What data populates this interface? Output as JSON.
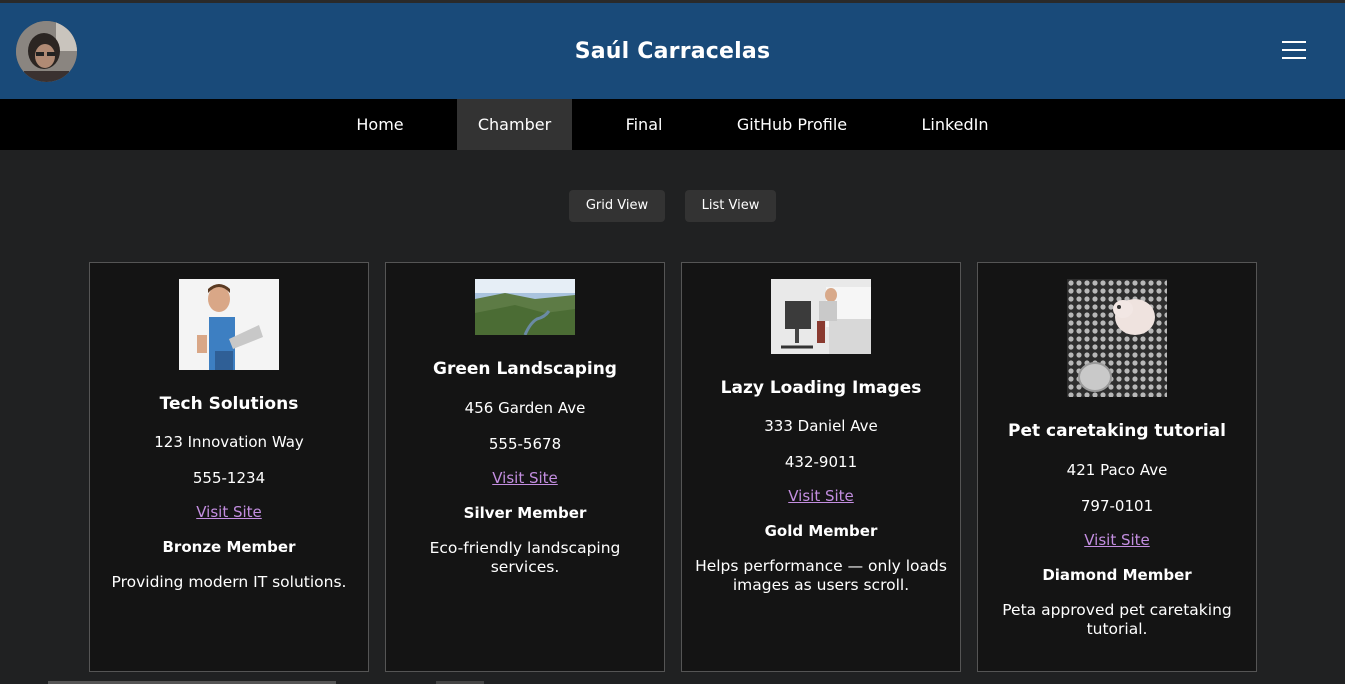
{
  "header": {
    "title": "Saúl Carracelas",
    "avatar_icon": "person-photo-icon",
    "menu_icon": "hamburger-icon"
  },
  "nav": {
    "items": [
      {
        "label": "Home"
      },
      {
        "label": "Chamber",
        "active": true
      },
      {
        "label": "Final"
      },
      {
        "label": "GitHub Profile"
      },
      {
        "label": "LinkedIn"
      }
    ]
  },
  "view_toggle": {
    "grid_label": "Grid View",
    "list_label": "List View"
  },
  "members": [
    {
      "name": "Tech Solutions",
      "address": "123 Innovation Way",
      "phone": "555-1234",
      "link": "Visit Site",
      "level": "Bronze Member",
      "description": "Providing modern IT solutions."
    },
    {
      "name": "Green Landscaping",
      "address": "456 Garden Ave",
      "phone": "555-5678",
      "link": "Visit Site",
      "level": "Silver Member",
      "description": "Eco-friendly landscaping services."
    },
    {
      "name": "Lazy Loading Images",
      "address": "333 Daniel Ave",
      "phone": "432-9011",
      "link": "Visit Site",
      "level": "Gold Member",
      "description": "Helps performance — only loads images as users scroll."
    },
    {
      "name": "Pet caretaking tutorial",
      "address": "421 Paco Ave",
      "phone": "797-0101",
      "link": "Visit Site",
      "level": "Diamond Member",
      "description": "Peta approved pet caretaking tutorial."
    }
  ],
  "colors": {
    "header_bg": "#194a79",
    "nav_bg": "#000000",
    "page_bg": "#202122",
    "card_bg": "#141414",
    "link": "#c38ee0"
  }
}
